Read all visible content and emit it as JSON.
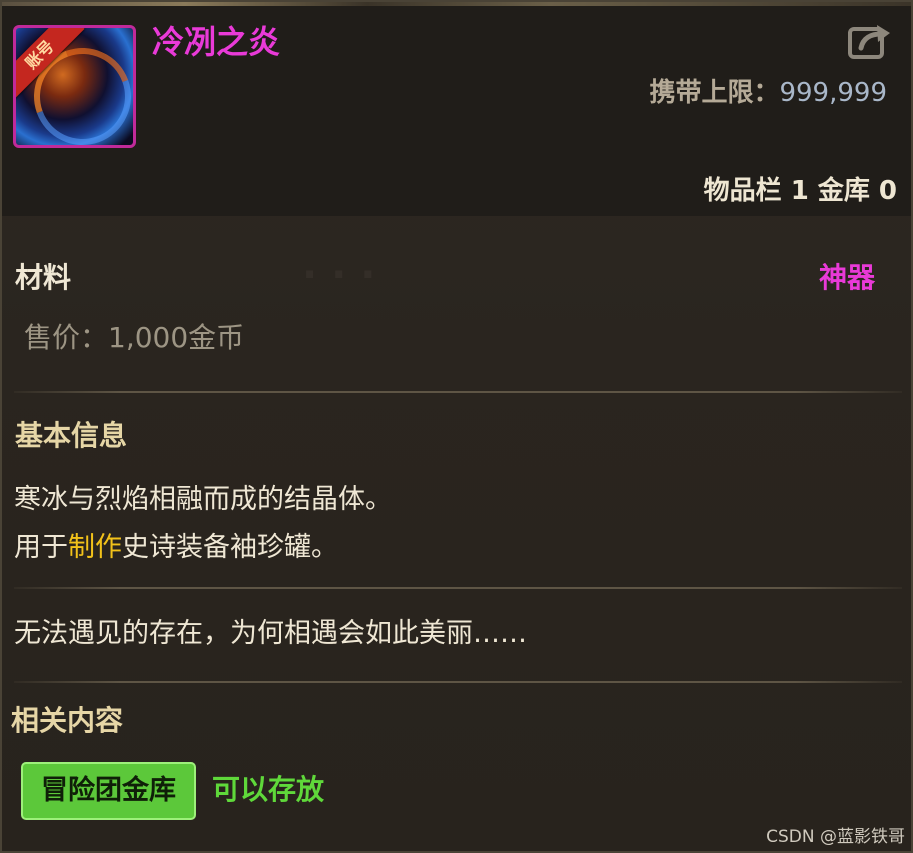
{
  "item": {
    "name": "冷冽之炎",
    "badge": "账号",
    "name_color": "#e93ad8",
    "icon_frame_color": "#c02a9a"
  },
  "header": {
    "carry_limit_label": "携带上限：",
    "carry_limit_value": "999,999",
    "inventory_text": "物品栏 1 金库 0",
    "share_icon": "share-export-icon"
  },
  "info": {
    "category": "材料",
    "rarity": "神器",
    "sell_price": "售价：1,000金币"
  },
  "basic": {
    "title": "基本信息",
    "line1": "寒冰与烈焰相融而成的结晶体。",
    "line2_prefix": "用于",
    "line2_highlight": "制作",
    "line2_suffix": "史诗装备袖珍罐。",
    "flavor": "无法遇见的存在，为何相遇会如此美丽……"
  },
  "related": {
    "title": "相关内容",
    "tag_label": "冒险团金库",
    "tag_status": "可以存放",
    "tag_color": "#5cc83a"
  },
  "watermark": "CSDN @蓝影铁哥"
}
